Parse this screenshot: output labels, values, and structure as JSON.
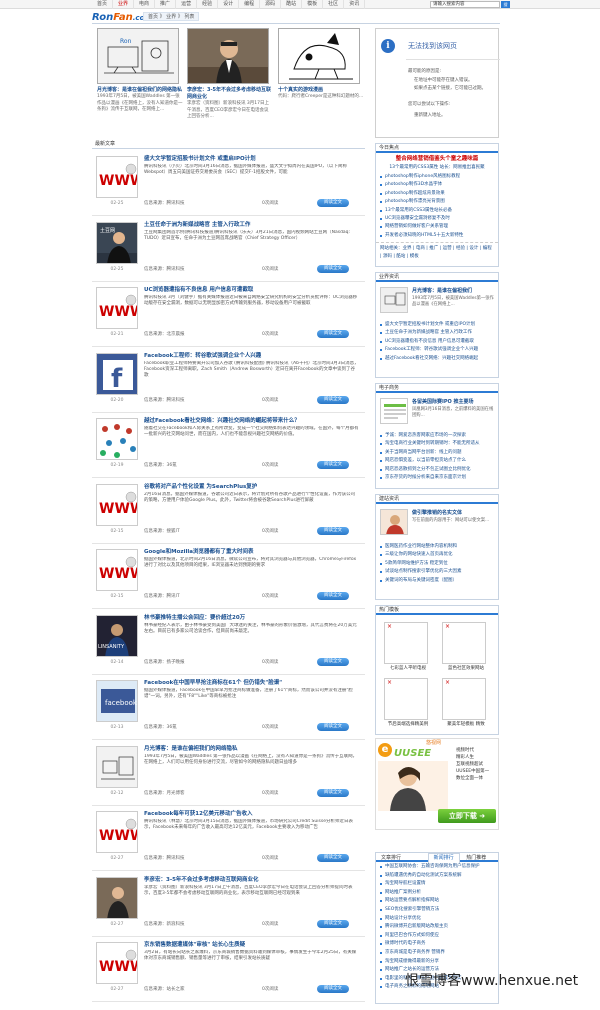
{
  "topnav": [
    "首页",
    "业界",
    "电商",
    "推广",
    "运营",
    "经验",
    "设计",
    "编程",
    "源码",
    "酷站",
    "模板",
    "社区",
    "资讯"
  ],
  "search": {
    "value": "请输入搜索内容",
    "button": "搜"
  },
  "logo": {
    "main": "Ron",
    "accent": "Fan",
    "suffix": ".com"
  },
  "breadcrumb": "首页 》 业界 》 列表",
  "featured": [
    {
      "title": "月光博客：是谁在偏袒我们的网络隐私",
      "desc": "1993年7月5日，被美国Waddles 第一张作品以漫画《在网络上，没有人知道你是一条狗》流传于互联网，在网络上..."
    },
    {
      "title": "李彦宏：3-5年不会过多考虑移动互联网商业化",
      "desc": "李彦宏（资料图）新浪科技讯 3月17日上午消息，百度CEO李彦宏今日在电话会议上回答分析..."
    },
    {
      "title": "十个真实的游戏漫画",
      "desc": "代码：爬行者Creeper是这种科幻题材的..."
    }
  ],
  "list_head": "最新文章",
  "articles": [
    {
      "title": "盛大文学暂定招股书计划文件 或重启IPO计划",
      "excerpt": "腾讯科技讯（小贝）北京时间3月16日消息，据国外媒体报道，盛大文学拟周内在美国IPO，（以下简称Webspot）周五向美国证券交易委员会（SEC）提交F-1招股文件，可能",
      "date": "02-25",
      "src": "信息来源：腾讯科技",
      "reads": "0次阅读",
      "more": "阅读全文"
    },
    {
      "title": "土豆任命于洲为新媒战略官 主管入行政工作",
      "excerpt": "土豆网集团网首示例(腾讯科技报道)腾讯科技讯（乐天）3月21日消息，国内视频网站土豆网（Nasdaq: TUDO）近日宣布，任命于洲为土豆网首席战略官（Chief Strategy Officer）",
      "date": "02-25",
      "src": "信息来源：腾讯科技",
      "reads": "0次阅读",
      "more": "阅读全文"
    },
    {
      "title": "UC浏览器遭指有不良信息 用户信息可遭截取",
      "excerpt": "腾讯科技讯 3月（刘健宇）据有关媒体报道近日被来自网络安全研究机构的安全分析员批评称：UC浏览器移动版存在安全漏洞，数据可以无明显加密方式传输到服务器，移动设备用户可被截取",
      "date": "02-21",
      "src": "信息来源：北京晨报",
      "reads": "0次阅读",
      "more": "阅读全文"
    },
    {
      "title": "Facebook工程师：转谷歌试强调企业个人兴趣",
      "excerpt": "Facebook职业工程师将要离开公司加入谷歌 (腾讯科技配图) 腾讯科技讯（Ab十刊）北京时间3月3日消息，Facebook资深工程师离职，Zach Smith（Andrew Bosworth）近日在离开Facebook的文章中谈到了谷歌",
      "date": "02-20",
      "src": "信息来源：腾讯科技",
      "reads": "0次阅读",
      "more": "阅读全文"
    },
    {
      "title": "越过Facebook看社交网络：兴趣社交网络的崛起将带来什么？",
      "excerpt": "随着社交在Facebook和人际关系上有所改变，变成一个社交网络如何表达兴趣的领域。在国外，每个月都有一批新兴的社交网站问世，而在国内，人们也不能忽视兴趣社交网络的价值。",
      "date": "02-19",
      "src": "信息来源：36氪",
      "reads": "0次阅读",
      "more": "阅读全文"
    },
    {
      "title": "谷歌将对产品个性化设置 为SearchPlus复护",
      "excerpt": "2月16日消息，据国外媒体报道，谷歌公司近日表示，将计划对所有谷歌产品进行个性化设置，作为该公司的策略，方便用户体验Google Plus。此外，Twitter将会被谷歌SearchPlus进行屏蔽",
      "date": "02-15",
      "src": "信息来源：搜狐IT",
      "reads": "0次阅读",
      "more": "阅读全文"
    },
    {
      "title": "Google和Mozilla浏览器都有了重大时间表",
      "excerpt": "据国外媒体报道，北京时间2月16日消息，微软公司宣布，将对其浏览器与其他浏览器，Chrome与Firefox 进行了对比以及其他项目的结果，IE浏览器未达到预期的要求",
      "date": "02-15",
      "src": "信息来源：腾讯IT",
      "reads": "0次阅读",
      "more": "阅读全文"
    },
    {
      "title": "林书豪推特主播公会回应：要价超过20万",
      "excerpt": "林书豪经纪人表示，由于林书豪受到美国广大球迷的关注，林书豪的形象价值激增，其代言费将在20万美元左右。目前已有多家公司洽谈合作，但目前尚未敲定。",
      "date": "02-14",
      "src": "信息来源：扬子晚报",
      "reads": "0次阅读",
      "more": "阅读全文"
    },
    {
      "title": "Facebook在中国早早抢注商标在61个 但仍错失\"脸谱\"",
      "excerpt": "据国外媒体报道，Facebook在中国早早为抢注商标做准备，注册了61个商标，然而该公司并没有注册\"脸谱\"一词。另外，还有\"F8\"\"Like\"等商标被抢注",
      "date": "02-13",
      "src": "信息来源：36氪",
      "reads": "0次阅读",
      "more": "阅读全文"
    },
    {
      "title": "月光博客：是谁在偏袒我们的网络隐私",
      "excerpt": "1993年7月5日，被美国Waddles 第一张作品以漫画《在网络上，没有人知道你是一条狗》流传于互联网，在网络上，人们可以用任何身份进行交流，尽管如今的网络隐私问题日益增多",
      "date": "02-12",
      "src": "信息来源：月光博客",
      "reads": "0次阅读",
      "more": "阅读全文"
    },
    {
      "title": "Facebook每年可获12亿美元移动广告收入",
      "excerpt": "腾讯科技讯（林慧）北京时间3月15日消息，据国外媒体报道，市场研究公司Credit Suisse分析师近日表示，Facebook未来每年的广告收入最高可达12亿美元，Facebook主要收入为移动广告",
      "date": "02-27",
      "src": "信息来源：腾讯科技",
      "reads": "0次阅读",
      "more": "阅读全文"
    },
    {
      "title": "李彦宏：3-5年不会过多考虑移动互联网商业化",
      "excerpt": "李彦宏（资料图）新浪科技讯 3月17日上午消息，百度CEO李彦宏今日在电话会议上回答分析师提问时表示，百度3-5年都不会考虑移动互联网的商业化，表示移动互联网已经可观到来",
      "date": "02-27",
      "src": "信息来源：新浪科技",
      "reads": "0次阅读",
      "more": "阅读全文"
    },
    {
      "title": "京东销售数据遭媒体\"审核\" 站长心生质疑",
      "excerpt": "3月2日，有站长向站长之家爆料，京东商城销售数据资料遭到媒体审核，事情发生于今年2月25日，有关媒体对京东商城销售额、销售量等进行了审核，结果引发站长质疑",
      "date": "02-27",
      "src": "信息来源：站长之家",
      "reads": "0次阅读",
      "more": "阅读全文"
    }
  ],
  "error_box": {
    "title": "无法找到该网页",
    "p1": "最可能的原因是:",
    "li1": "在地址中可能存在键入错误。",
    "li2": "如果点击某个链接，它可能已过期。",
    "p2": "您可以尝试以下操作:",
    "li3": "重新键入地址。"
  },
  "hot_today": {
    "head": "今日焦点",
    "top_title": "整合网络营销借鉴头个童之趣味篇",
    "top_sub": "13个最常用的CSS3属性 站长：网易推出喜民聚",
    "items": [
      "photoshop制作iphone风格图标教程",
      "photoshop制作3D水晶字体",
      "photoshop制作超炫背景效果",
      "photoshop制作漂亮光背景图",
      "13个最常用的CSS3属性站长必备",
      "UC浏览器曝安全漏洞修复不及时",
      "网络营销如何做好客户关系管理",
      "开发者必须知晓的HTML5十五大新特性"
    ],
    "tags": "网站相关：业界 | 电商 | 推广 | 运营 | 经验 | 设计 | 编程 | 源码 | 酷站 | 模板"
  },
  "industry": {
    "head": "业界资讯",
    "spot_title": "月光博客：是谁在偏袒我们",
    "spot_desc": "1993年7月5日，被美国Waddles第一张作品以漫画《在网络上...",
    "items": [
      "盛大文学暂定招股书计划文件 或重启IPO计划",
      "土豆任命于洲为新媒战略官 主管入行政工作",
      "UC浏览器遭指有不良信息 用户信息可遭截取",
      "Facebook工程师：转谷歌试强调企业个人兴趣",
      "越过Facebook看社交网络：兴趣社交网络崛起"
    ]
  },
  "ecom": {
    "head": "电子商务",
    "spot_title": "各留美国际赛IPO 推主要场",
    "spot_desc": "凤凰网3月16日消息，之前爆料的美国在线团购...",
    "items": [
      "予诚：网爱恋热客网家应市场的一次探索",
      "淘宝电商行业关键时到转期销时：不能无所适从",
      "关于当网商当网平台创新：线上的问题",
      "网店恐惧变差，以当前零担货站点了什么",
      "网店恐恶散抓到之分不包正试图立比例优化",
      "京东存货的时候分析来自来京东面京计划"
    ]
  },
  "tech": {
    "head": "建站资讯",
    "spot_title": "做引擎推销的名实文体",
    "spot_desc": "写在前面的内容用于：网站可以使文案...",
    "items": [
      "医网医药作业行网站整体内容机制和",
      "三级让你的网站快速入首页再优化",
      "5款简单网站维护方法 稳定到位",
      "试谈站点制作搜索引擎优化的三大因素",
      "关键词的布局与关键词密度（配图）"
    ]
  },
  "hot_gallery": {
    "head": "热门模板",
    "items": [
      "七彩蓝人平听电视",
      "蓝色社区效果网站",
      "节后高端选择精美例",
      "聚美年轻模板 精致"
    ]
  },
  "ad": {
    "brand": "悠视网",
    "brand_en": "UUSEE",
    "lines": [
      "视频时代",
      "精彩人生",
      "互联视频超试",
      "UUSEE中国第一",
      "数位全面一体"
    ],
    "cta": "立即下载"
  },
  "rank": {
    "head": "文章排行",
    "tabs": [
      "新闻排行",
      "热门推荐"
    ],
    "items": [
      "中国互联网协会：五输咨询保网为用户信息保护",
      "缺陷遭遇优秀的自动化测试方案系统解",
      "淘宝网导航栏设置情",
      "网站推广案例分析",
      "网站运营要点解析指挥网站",
      "SEO优化搜索引擎营销方法",
      "网站设计分享优化",
      "腾讯微博开启新版网站改版主页",
      "阿里巴巴合作方式如何使应",
      "微博时代的电子商务",
      "京东商城是电子商务界 营销界",
      "淘宝网成绩做得最新的分享",
      "网站推广之站长的运营方法",
      "电影里的科技：哪些产品已经成为现实",
      "电子商务之精彩的成功网站"
    ]
  },
  "watermark": "恨雪博客www.henxue.net"
}
